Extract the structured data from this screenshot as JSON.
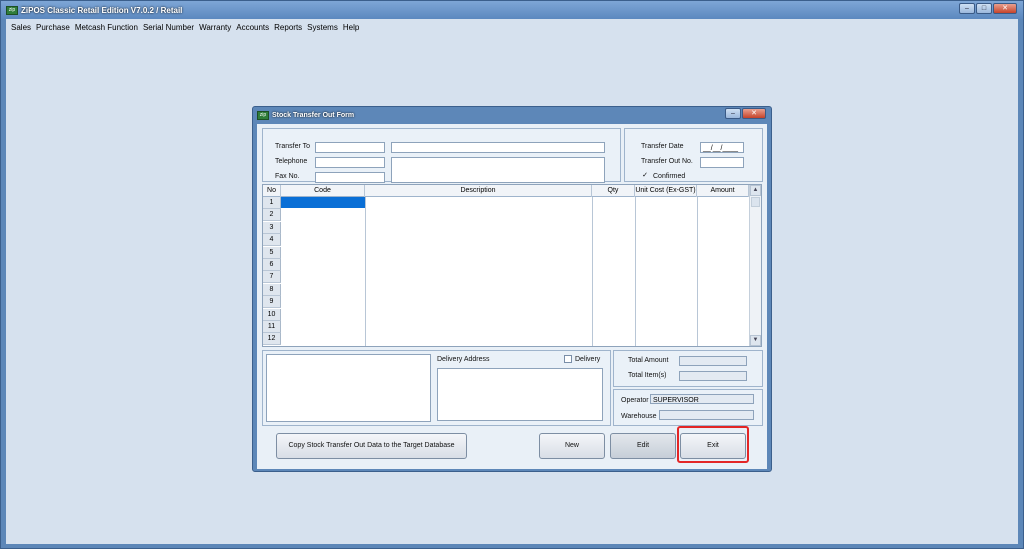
{
  "app": {
    "title": "ZiPOS Classic Retail Edition V7.0.2 / Retail",
    "icon": "zipos-app-icon"
  },
  "window_controls": {
    "minimize": "–",
    "maximize": "□",
    "close": "✕"
  },
  "menu": [
    "Sales",
    "Purchase",
    "Metcash Function",
    "Serial Number",
    "Warranty",
    "Accounts",
    "Reports",
    "Systems",
    "Help"
  ],
  "dialog": {
    "title": "Stock Transfer Out Form",
    "controls": {
      "minimize": "–",
      "close": "✕"
    },
    "fields": {
      "transfer_to": "Transfer To",
      "telephone": "Telephone",
      "fax_no": "Fax No.",
      "transfer_date": "Transfer Date",
      "transfer_date_value": "__/__/____",
      "transfer_out_no": "Transfer Out No.",
      "confirmed": "Confirmed",
      "confirmed_mark": "✓"
    },
    "grid": {
      "columns": [
        "No",
        "Code",
        "Description",
        "Qty",
        "Unit Cost (Ex-GST)",
        "Amount"
      ],
      "rows": [
        "1",
        "2",
        "3",
        "4",
        "5",
        "6",
        "7",
        "8",
        "9",
        "10",
        "11",
        "12"
      ],
      "scroll_up": "▲",
      "scroll_down": "▼"
    },
    "delivery": {
      "address_label": "Delivery Address",
      "delivery_label": "Delivery"
    },
    "totals": {
      "total_amount": "Total Amount",
      "total_items": "Total Item(s)"
    },
    "operator": {
      "label": "Operator",
      "value": "SUPERVISOR",
      "warehouse": "Warehouse"
    },
    "buttons": {
      "copy": "Copy Stock Transfer Out Data to the Target Database",
      "new": "New",
      "edit": "Edit",
      "exit": "Exit"
    }
  },
  "colors": {
    "highlight": "#e32626",
    "selection": "#0a6fd6"
  }
}
